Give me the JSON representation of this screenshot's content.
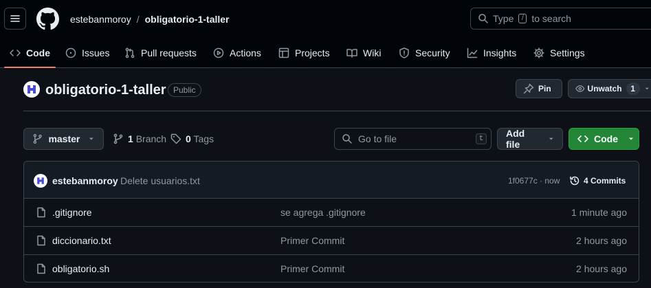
{
  "header": {
    "owner": "estebanmoroy",
    "separator": "/",
    "repo": "obligatorio-1-taller",
    "search": {
      "prefix": "Type",
      "key": "/",
      "suffix": "to search"
    }
  },
  "tabs": [
    {
      "label": "Code",
      "icon": "code-icon",
      "active": true
    },
    {
      "label": "Issues",
      "icon": "issue-opened-icon"
    },
    {
      "label": "Pull requests",
      "icon": "git-pull-request-icon"
    },
    {
      "label": "Actions",
      "icon": "play-icon"
    },
    {
      "label": "Projects",
      "icon": "table-icon"
    },
    {
      "label": "Wiki",
      "icon": "book-icon"
    },
    {
      "label": "Security",
      "icon": "shield-icon"
    },
    {
      "label": "Insights",
      "icon": "graph-icon"
    },
    {
      "label": "Settings",
      "icon": "gear-icon"
    }
  ],
  "repo": {
    "title": "obligatorio-1-taller",
    "visibility": "Public",
    "pin_label": "Pin",
    "watch_label": "Unwatch",
    "watch_count": "1"
  },
  "toolbar": {
    "branch": "master",
    "branches_count": "1",
    "branches_label": "Branch",
    "tags_count": "0",
    "tags_label": "Tags",
    "goto_placeholder": "Go to file",
    "goto_key": "t",
    "add_file_label": "Add file",
    "code_label": "Code"
  },
  "commit": {
    "author": "estebanmoroy",
    "message": "Delete usuarios.txt",
    "hash_time": "1f0677c · now",
    "commits_label": "4 Commits"
  },
  "files": [
    {
      "name": ".gitignore",
      "message": "se agrega .gitignore",
      "time": "1 minute ago"
    },
    {
      "name": "diccionario.txt",
      "message": "Primer Commit",
      "time": "2 hours ago"
    },
    {
      "name": "obligatorio.sh",
      "message": "Primer Commit",
      "time": "2 hours ago"
    }
  ],
  "colors": {
    "background": "#0d1117",
    "header": "#010409",
    "border": "#3d444d",
    "active_tab_underline": "#f78166",
    "code_button": "#238636",
    "avatar": "#4b4bd1"
  }
}
